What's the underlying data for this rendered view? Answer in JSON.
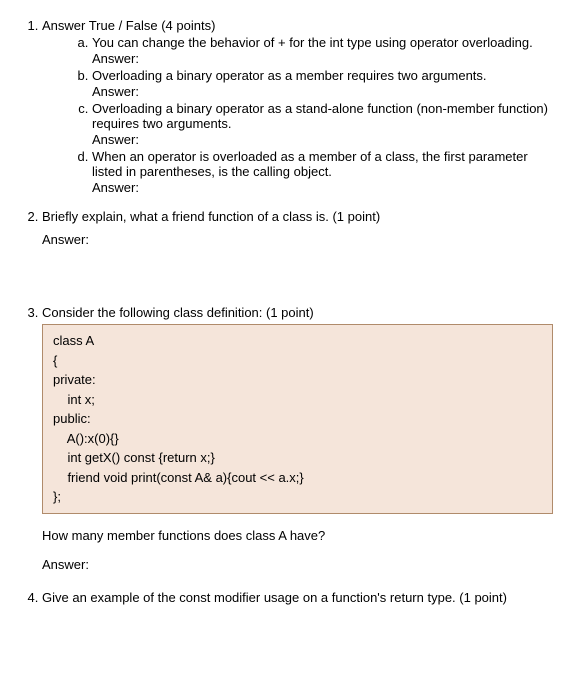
{
  "q1": {
    "prompt": "Answer True / False (4 points)",
    "items": {
      "a": "You can change the behavior of + for the int type using operator overloading.",
      "b": "Overloading a binary operator as a member requires two arguments.",
      "c": "Overloading a binary operator as a stand-alone function (non-member function) requires two arguments.",
      "d": "When an operator is overloaded as a member of a class, the first parameter listed in parentheses, is the calling object."
    },
    "answer_label": "Answer:"
  },
  "q2": {
    "prompt": "Briefly explain, what a friend function of a class is. (1 point)",
    "answer_label": "Answer:"
  },
  "q3": {
    "prompt": "Consider the following class definition: (1 point)",
    "code": {
      "l1": "class A",
      "l2": "{",
      "l3": "private:",
      "l4": "    int x;",
      "l5": "public:",
      "l6": "    A():x(0){}",
      "l7": "    int getX() const {return x;}",
      "l8": "    friend void print(const A& a){cout << a.x;}",
      "l9": "",
      "l10": "};"
    },
    "followup": "How many member functions does class A have?",
    "answer_label": "Answer:"
  },
  "q4": {
    "prompt": "Give an example of the const modifier usage on a function's return type. (1 point)"
  }
}
